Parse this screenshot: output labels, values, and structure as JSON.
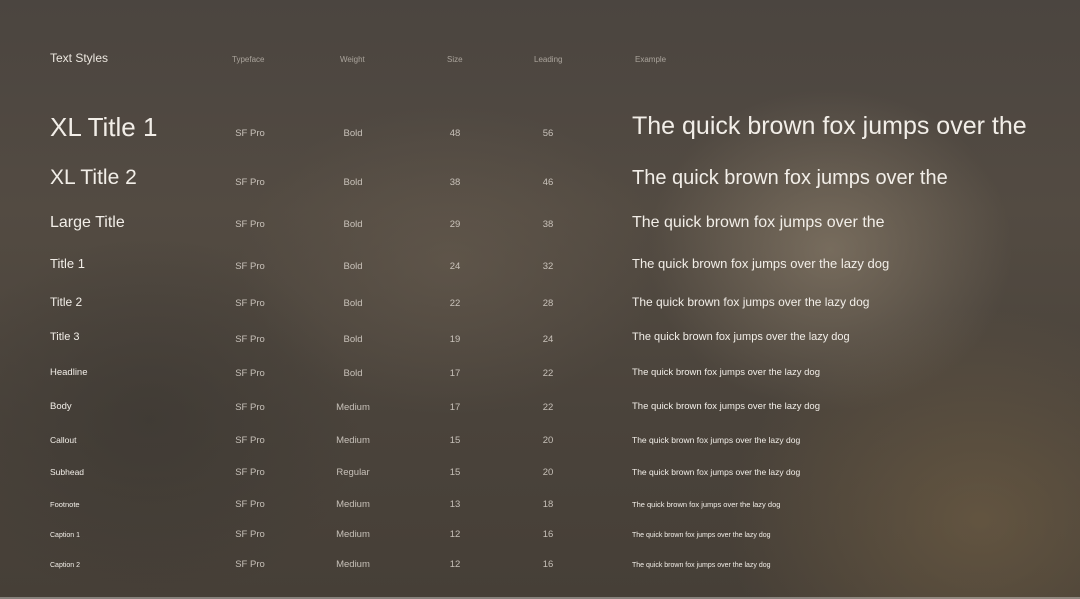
{
  "header": {
    "title": "Text Styles",
    "columns": [
      "Typeface",
      "Weight",
      "Size",
      "Leading",
      "Example"
    ]
  },
  "rows": [
    {
      "name": "XL Title 1",
      "typeface": "SF Pro",
      "weight": "Bold",
      "size": "48",
      "leading": "56",
      "example": "The quick brown fox jumps over the"
    },
    {
      "name": "XL Title 2",
      "typeface": "SF Pro",
      "weight": "Bold",
      "size": "38",
      "leading": "46",
      "example": "The quick brown fox jumps over the"
    },
    {
      "name": "Large Title",
      "typeface": "SF Pro",
      "weight": "Bold",
      "size": "29",
      "leading": "38",
      "example": "The quick brown fox jumps over the"
    },
    {
      "name": "Title 1",
      "typeface": "SF Pro",
      "weight": "Bold",
      "size": "24",
      "leading": "32",
      "example": "The quick brown fox jumps over the lazy dog"
    },
    {
      "name": "Title 2",
      "typeface": "SF Pro",
      "weight": "Bold",
      "size": "22",
      "leading": "28",
      "example": "The quick brown fox jumps over the lazy dog"
    },
    {
      "name": "Title 3",
      "typeface": "SF Pro",
      "weight": "Bold",
      "size": "19",
      "leading": "24",
      "example": "The quick brown fox jumps over the lazy dog"
    },
    {
      "name": "Headline",
      "typeface": "SF Pro",
      "weight": "Bold",
      "size": "17",
      "leading": "22",
      "example": "The quick brown fox jumps over the lazy dog"
    },
    {
      "name": "Body",
      "typeface": "SF Pro",
      "weight": "Medium",
      "size": "17",
      "leading": "22",
      "example": "The quick brown fox jumps over the lazy dog"
    },
    {
      "name": "Callout",
      "typeface": "SF Pro",
      "weight": "Medium",
      "size": "15",
      "leading": "20",
      "example": "The quick brown fox jumps over the lazy dog"
    },
    {
      "name": "Subhead",
      "typeface": "SF Pro",
      "weight": "Regular",
      "size": "15",
      "leading": "20",
      "example": "The quick brown fox jumps over the lazy dog"
    },
    {
      "name": "Footnote",
      "typeface": "SF Pro",
      "weight": "Medium",
      "size": "13",
      "leading": "18",
      "example": "The quick brown fox jumps over the lazy dog"
    },
    {
      "name": "Caption 1",
      "typeface": "SF Pro",
      "weight": "Medium",
      "size": "12",
      "leading": "16",
      "example": "The quick brown fox jumps over the lazy dog"
    },
    {
      "name": "Caption 2",
      "typeface": "SF Pro",
      "weight": "Medium",
      "size": "12",
      "leading": "16",
      "example": "The quick brown fox jumps over the lazy dog"
    }
  ]
}
